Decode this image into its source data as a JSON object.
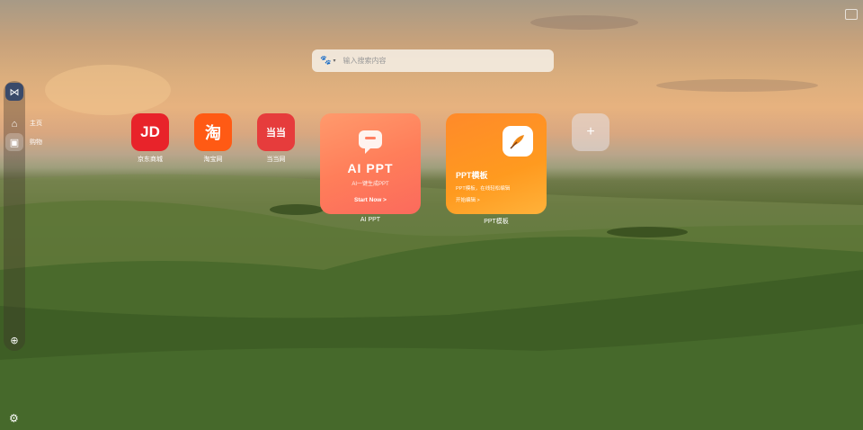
{
  "search": {
    "placeholder": "输入搜索内容"
  },
  "sidebar": {
    "items": [
      {
        "label": "主页"
      },
      {
        "label": "购物"
      }
    ]
  },
  "tiles": [
    {
      "glyph": "JD",
      "label": "京东商城",
      "color": "#e8232a"
    },
    {
      "glyph": "淘",
      "label": "淘宝网",
      "color": "#ff5a14"
    },
    {
      "glyph": "当当",
      "label": "当当网",
      "color": "#e63c3c"
    }
  ],
  "cards": {
    "ai_ppt": {
      "title": "AI PPT",
      "subtitle": "AI一键生成PPT",
      "cta": "Start Now >",
      "label": "AI PPT"
    },
    "ppt_template": {
      "title": "PPT模板",
      "subtitle": "PPT模板，在线轻松编辑",
      "cta": "开始编辑 >",
      "label": "PPT模板"
    }
  },
  "add_tile": {
    "glyph": "+"
  },
  "colors": {
    "jd_red": "#e8232a",
    "taobao_orange": "#ff5a14",
    "dangdang_red": "#e63c3c",
    "ai_ppt_gradient": "#ff8062",
    "ppt_template_gradient": "#ff9a1f"
  }
}
